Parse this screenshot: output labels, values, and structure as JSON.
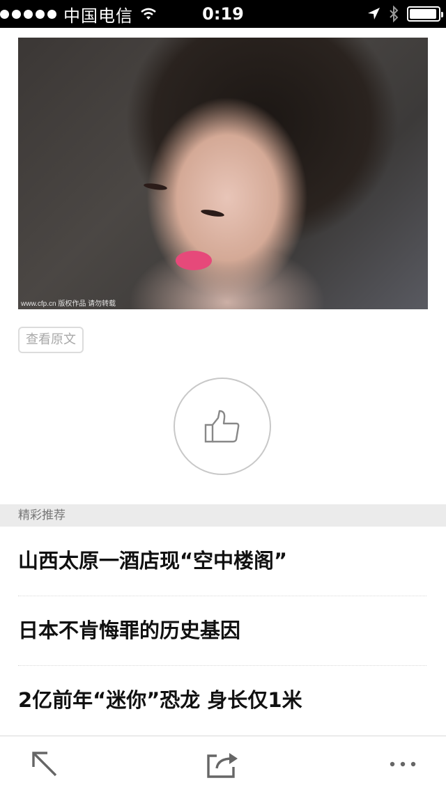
{
  "status_bar": {
    "carrier": "中国电信",
    "time": "0:19",
    "battery_level": 0.95
  },
  "article": {
    "photo_watermark": "www.cfp.cn 版权作品 请勿转载",
    "view_original_label": "查看原文"
  },
  "recommend": {
    "header": "精彩推荐",
    "items": [
      {
        "title": "山西太原一酒店现“空中楼阁”"
      },
      {
        "title": "日本不肯悔罪的历史基因"
      },
      {
        "title": "2亿前年“迷你”恐龙 身长仅1米"
      }
    ]
  },
  "toolbar": {
    "icons": [
      "back-arrow-icon",
      "share-icon",
      "more-icon"
    ]
  },
  "colors": {
    "status_bar_bg": "#000000",
    "section_bg": "#ebebeb",
    "lips_accent": "#e6497a"
  }
}
